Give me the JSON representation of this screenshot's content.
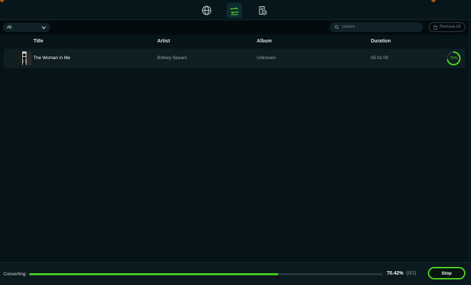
{
  "colors": {
    "accent": "#4cd21e",
    "background": "#061318",
    "row": "#0e1e23"
  },
  "topbar": {
    "tabs": [
      {
        "name": "web",
        "icon": "globe-icon"
      },
      {
        "name": "converting",
        "icon": "convert-icon",
        "active": true
      },
      {
        "name": "converted",
        "icon": "converted-file-icon"
      }
    ]
  },
  "toolbar": {
    "filter_value": "All",
    "search_placeholder": "Search",
    "remove_all_label": "Remove All"
  },
  "table": {
    "columns": [
      "Title",
      "Artist",
      "Album",
      "Duration"
    ],
    "rows": [
      {
        "title": "The Woman in Me",
        "artist": "Britney Spears",
        "album": "Unknown",
        "duration": "05:31:00",
        "progress_label": "70%",
        "progress": 0.7
      }
    ]
  },
  "footer": {
    "status_label": "Converting:",
    "progress_percent": 70.42,
    "percent_text": "70.42%",
    "count_text": "(0/1)",
    "stop_label": "Stop"
  }
}
